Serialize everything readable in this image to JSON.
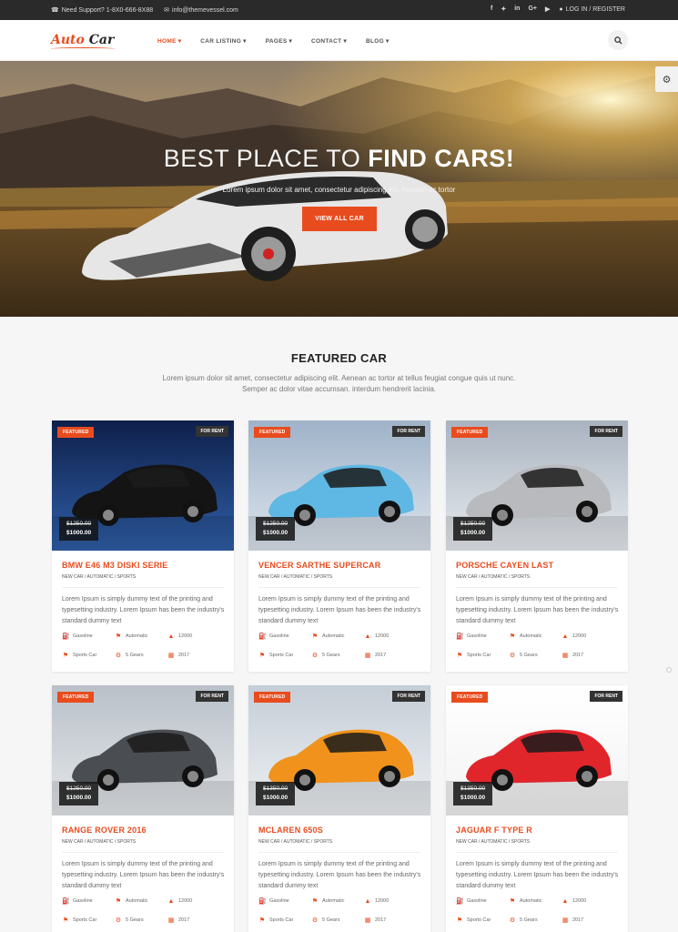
{
  "topbar": {
    "support": "Need Support? 1-8X0-666-8X88",
    "email": "info@themevessel.com",
    "social": [
      "f",
      "✦",
      "in",
      "G+",
      "▶"
    ],
    "login": "LOG IN / REGISTER"
  },
  "logo": {
    "part1": "Auto",
    "part2": "Car"
  },
  "nav": [
    {
      "label": "HOME",
      "active": true
    },
    {
      "label": "CAR LISTING",
      "active": false
    },
    {
      "label": "PAGES",
      "active": false
    },
    {
      "label": "CONTACT",
      "active": false
    },
    {
      "label": "BLOG",
      "active": false
    }
  ],
  "hero": {
    "title_thin": "BEST PLACE TO",
    "title_bold": "FIND CARS!",
    "subtitle": "Lorem ipsum dolor sit amet, consectetur adipiscing elit. Aenean ac tortor",
    "button": "VIEW ALL CAR"
  },
  "featured": {
    "title": "FEATURED CAR",
    "description": "Lorem ipsum dolor sit amet, consectetur adipiscing elit. Aenean ac tortor at tellus feugiat congue quis ut nunc. Semper ac dolor vitae accumsan. interdum hendrerit lacinia."
  },
  "labels": {
    "featured": "FEATURED",
    "for_rent": "FOR RENT"
  },
  "colors": {
    "accent": "#e84c1e",
    "dark": "#2a2a2a"
  },
  "cars": [
    {
      "name": "BMW E46 M3 DISKI SERIE",
      "old_price": "$1250.00",
      "price": "$1000.00",
      "tags": "NEW CAR /  AUTOMATIC /  SPORTS",
      "desc": "Lorem Ipsum is simply dummy text of the printing and typesetting industry. Lorem Ipsum has been the industry's standard dummy text",
      "specs": [
        "Gasoline",
        "Automatic",
        "12000",
        "Sports Car",
        "5 Gears",
        "2017"
      ],
      "car_color": "#141414"
    },
    {
      "name": "VENCER SARTHE SUPERCAR",
      "old_price": "$1250.00",
      "price": "$1000.00",
      "tags": "NEW CAR /  AUTOMATIC /  SPORTS",
      "desc": "Lorem Ipsum is simply dummy text of the printing and typesetting industry. Lorem Ipsum has been the industry's standard dummy text",
      "specs": [
        "Gasoline",
        "Automatic",
        "12000",
        "Sports Car",
        "5 Gears",
        "2017"
      ],
      "car_color": "#5fb8e3"
    },
    {
      "name": "PORSCHE CAYEN LAST",
      "old_price": "$1250.00",
      "price": "$1000.00",
      "tags": "NEW CAR /  AUTOMATIC /  SPORTS",
      "desc": "Lorem Ipsum is simply dummy text of the printing and typesetting industry. Lorem Ipsum has been the industry's standard dummy text",
      "specs": [
        "Gasoline",
        "Automatic",
        "12000",
        "Sports Car",
        "5 Gears",
        "2017"
      ],
      "car_color": "#b8babd"
    },
    {
      "name": "RANGE ROVER 2016",
      "old_price": "$1250.00",
      "price": "$1000.00",
      "tags": "NEW CAR /  AUTOMATIC /  SPORTS",
      "desc": "Lorem Ipsum is simply dummy text of the printing and typesetting industry. Lorem Ipsum has been the industry's standard dummy text",
      "specs": [
        "Gasoline",
        "Automatic",
        "12000",
        "Sports Car",
        "5 Gears",
        "2017"
      ],
      "car_color": "#4a4d52"
    },
    {
      "name": "MCLAREN 650S",
      "old_price": "$1350.00",
      "price": "$1000.00",
      "tags": "NEW CAR /  AUTOMATIC /  SPORTS",
      "desc": "Lorem Ipsum is simply dummy text of the printing and typesetting industry. Lorem Ipsum has been the industry's standard dummy text",
      "specs": [
        "Gasoline",
        "Automatic",
        "12000",
        "Sports Car",
        "5 Gears",
        "2017"
      ],
      "car_color": "#f0921c"
    },
    {
      "name": "JAGUAR F TYPE R",
      "old_price": "$1350.00",
      "price": "$1000.00",
      "tags": "NEW CAR /  AUTOMATIC /  SPORTS",
      "desc": "Lorem Ipsum is simply dummy text of the printing and typesetting industry. Lorem Ipsum has been the industry's standard dummy text",
      "specs": [
        "Gasoline",
        "Automatic",
        "12000",
        "Sports Car",
        "5 Gears",
        "2017"
      ],
      "car_color": "#e0262b"
    }
  ]
}
